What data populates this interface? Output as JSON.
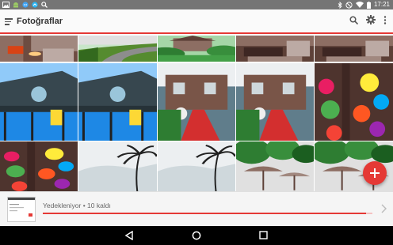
{
  "status_bar": {
    "time": "17:21",
    "left_icons": [
      "image-icon",
      "android-icon",
      "chat-icon",
      "messaging-icon",
      "search-icon"
    ],
    "right_icons": [
      "bluetooth-icon",
      "no-sound-icon",
      "wifi-icon",
      "battery-icon"
    ]
  },
  "toolbar": {
    "title": "Fotoğraflar",
    "actions": [
      "search-icon",
      "settings-icon",
      "more-vert-icon"
    ]
  },
  "photos": [
    {
      "name": "photo-restaurant-street",
      "kind": "street"
    },
    {
      "name": "photo-curved-road",
      "kind": "road"
    },
    {
      "name": "photo-garden-house",
      "kind": "garden"
    },
    {
      "name": "photo-piano-room-1",
      "kind": "piano"
    },
    {
      "name": "photo-piano-room-2",
      "kind": "piano"
    },
    {
      "name": "photo-balcony-blue-1",
      "kind": "balcony"
    },
    {
      "name": "photo-balcony-blue-2",
      "kind": "balcony"
    },
    {
      "name": "photo-red-carpet-house-1",
      "kind": "carpet"
    },
    {
      "name": "photo-red-carpet-house-2",
      "kind": "carpet"
    },
    {
      "name": "photo-colorful-flowers-1",
      "kind": "flowers"
    },
    {
      "name": "photo-colorful-flowers-2",
      "kind": "flowers"
    },
    {
      "name": "photo-palm-tree-1",
      "kind": "palm"
    },
    {
      "name": "photo-palm-tree-2",
      "kind": "palm"
    },
    {
      "name": "photo-beach-umbrellas-1",
      "kind": "umbrella"
    },
    {
      "name": "photo-beach-umbrellas-2",
      "kind": "umbrella"
    }
  ],
  "fab": {
    "icon": "plus-icon"
  },
  "backup": {
    "status_text": "Yedekleniyor • 10 kaldı",
    "progress": 0.98,
    "chevron_icon": "chevron-right-icon"
  },
  "nav_bar": {
    "icons": [
      "back-icon",
      "home-icon",
      "recents-icon"
    ]
  },
  "colors": {
    "accent": "#e53935",
    "status_bar": "#757575",
    "nav_bar": "#000000"
  }
}
